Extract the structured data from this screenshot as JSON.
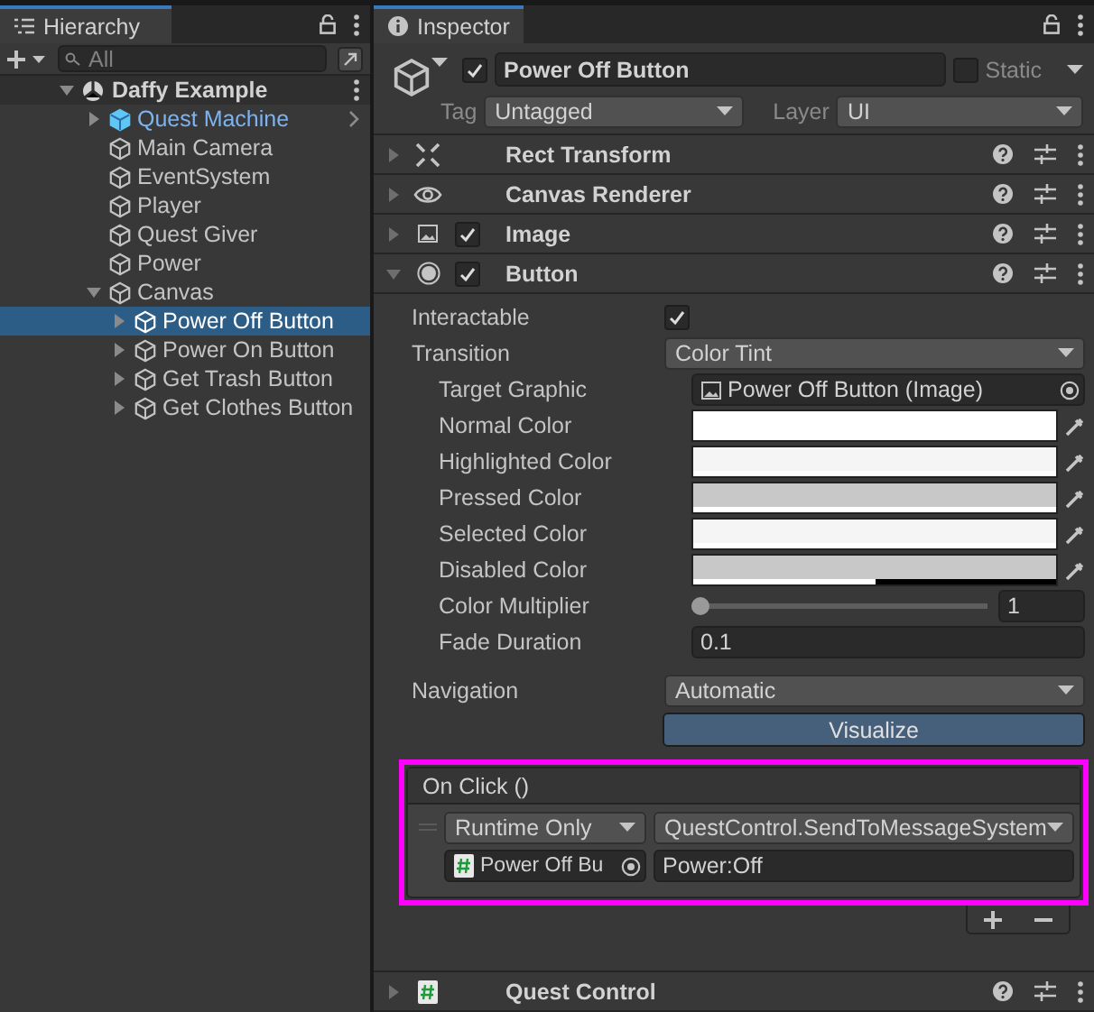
{
  "hierarchy": {
    "tab": "Hierarchy",
    "search": {
      "placeholder": "All"
    },
    "scene": {
      "name": "Daffy Example",
      "expanded": true
    },
    "items": [
      {
        "name": "Quest Machine",
        "kind": "prefab",
        "selected": false,
        "expanded": false
      },
      {
        "name": "Main Camera",
        "kind": "object",
        "selected": false
      },
      {
        "name": "EventSystem",
        "kind": "object",
        "selected": false
      },
      {
        "name": "Player",
        "kind": "object",
        "selected": false
      },
      {
        "name": "Quest Giver",
        "kind": "object",
        "selected": false
      },
      {
        "name": "Power",
        "kind": "object",
        "selected": false
      },
      {
        "name": "Canvas",
        "kind": "object",
        "selected": false,
        "expanded": true,
        "children": [
          {
            "name": "Power Off Button",
            "kind": "object",
            "selected": true,
            "expanded": false
          },
          {
            "name": "Power On Button",
            "kind": "object",
            "selected": false,
            "expanded": false
          },
          {
            "name": "Get Trash Button",
            "kind": "object",
            "selected": false,
            "expanded": false
          },
          {
            "name": "Get Clothes Button",
            "kind": "object",
            "selected": false,
            "expanded": false
          }
        ]
      }
    ]
  },
  "inspector": {
    "tab": "Inspector",
    "object": {
      "active": true,
      "name": "Power Off Button",
      "static": false,
      "static_label": "Static",
      "tag_label": "Tag",
      "tag": "Untagged",
      "layer_label": "Layer",
      "layer": "UI"
    },
    "components": [
      {
        "name": "Rect Transform",
        "kind": "rect",
        "expanded": false
      },
      {
        "name": "Canvas Renderer",
        "kind": "renderer",
        "expanded": false
      },
      {
        "name": "Image",
        "kind": "image",
        "enabled": true,
        "expanded": false
      },
      {
        "name": "Button",
        "kind": "button",
        "enabled": true,
        "expanded": true
      }
    ],
    "properties": [
      {
        "kind": "checkbox",
        "label": "Interactable",
        "checked": true
      },
      {
        "kind": "dropdown",
        "label": "Transition",
        "value": "Color Tint",
        "children": [
          {
            "kind": "object",
            "label": "Target Graphic",
            "value": "Power Off Button (Image)"
          },
          {
            "kind": "color",
            "label": "Normal Color",
            "color": "#ffffff",
            "level": 1
          },
          {
            "kind": "color",
            "label": "Highlighted Color",
            "color": "#f5f5f5",
            "level": 1
          },
          {
            "kind": "color",
            "label": "Pressed Color",
            "color": "#c8c8c8",
            "level": 1
          },
          {
            "kind": "color",
            "label": "Selected Color",
            "color": "#f5f5f5",
            "level": 1
          },
          {
            "kind": "color",
            "label": "Disabled Color",
            "color": "#c8c8c8",
            "level": 0.5
          },
          {
            "kind": "slider",
            "label": "Color Multiplier",
            "level": 0,
            "value": "1"
          },
          {
            "kind": "number",
            "label": "Fade Duration",
            "value": "0.1"
          }
        ]
      },
      {
        "kind": "dropdown",
        "label": "Navigation",
        "value": "Automatic"
      },
      {
        "kind": "button",
        "label": "Visualize"
      }
    ],
    "event": {
      "title": "On Click ()",
      "highlighted": true,
      "listeners": [
        {
          "runtime": "Runtime Only",
          "function": "QuestControl.SendToMessageSystem",
          "object": "Power Off Bu",
          "argument": "Power:Off"
        }
      ]
    },
    "footer_component": {
      "name": "Quest Control",
      "kind": "script",
      "expanded": false
    }
  }
}
